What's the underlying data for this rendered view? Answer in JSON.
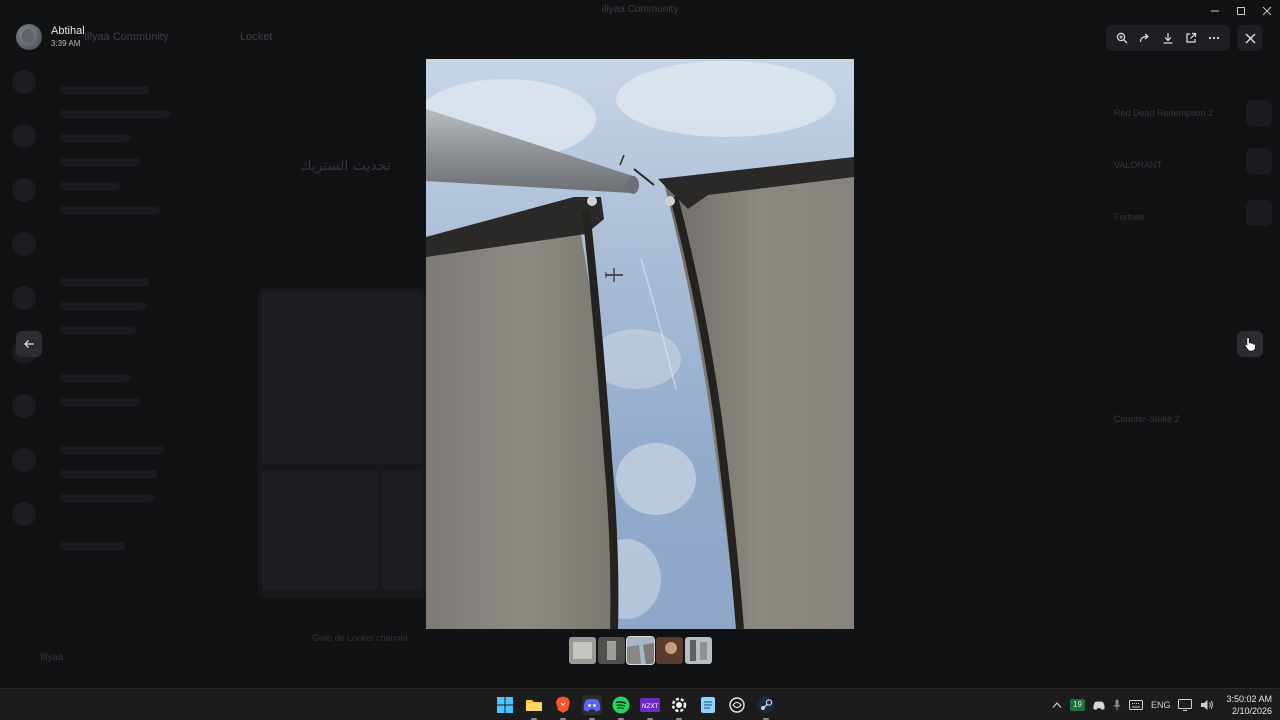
{
  "window": {
    "title": "Illyaa Community",
    "controls": [
      "minimize",
      "maximize",
      "close"
    ]
  },
  "background_app": {
    "server_name": "Illyaa Community",
    "channel_name": "Locket",
    "arabic_title": "تحديث الستريك",
    "composer_placeholder": "Grab de Locket channel",
    "user_name": "Illyaa"
  },
  "viewer": {
    "author": "Abtihal",
    "timestamp": "3:39 AM",
    "toolbar": [
      {
        "name": "zoom-icon"
      },
      {
        "name": "forward-icon"
      },
      {
        "name": "download-icon"
      },
      {
        "name": "open-external-icon"
      },
      {
        "name": "more-icon"
      }
    ],
    "thumbnails": 5,
    "active_thumbnail": 3
  },
  "right_panel": {
    "items": [
      "Red Dead Redemption 2",
      "VALORANT",
      "Fortnite",
      "Counter-Strike 2"
    ]
  },
  "taskbar": {
    "apps": [
      "windows-start",
      "file-explorer",
      "brave",
      "discord",
      "spotify",
      "nzxt",
      "steelseries",
      "notepad",
      "chatgpt",
      "steam"
    ],
    "tray": {
      "badge": "19",
      "language": "ENG",
      "time": "3:50:02 AM",
      "date": "2/10/2026"
    }
  },
  "colors": {
    "overlay": "#000000",
    "toolbar_bg": "#1e1f22",
    "taskbar_bg": "#1c1c1c"
  }
}
